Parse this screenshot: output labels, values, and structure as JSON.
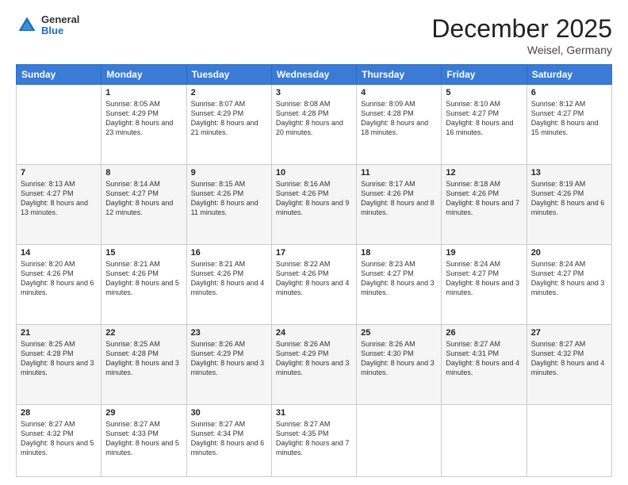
{
  "header": {
    "logo_general": "General",
    "logo_blue": "Blue",
    "month_title": "December 2025",
    "location": "Weisel, Germany"
  },
  "calendar": {
    "days_of_week": [
      "Sunday",
      "Monday",
      "Tuesday",
      "Wednesday",
      "Thursday",
      "Friday",
      "Saturday"
    ],
    "weeks": [
      [
        {
          "day": "",
          "sunrise": "",
          "sunset": "",
          "daylight": ""
        },
        {
          "day": "1",
          "sunrise": "Sunrise: 8:05 AM",
          "sunset": "Sunset: 4:29 PM",
          "daylight": "Daylight: 8 hours and 23 minutes."
        },
        {
          "day": "2",
          "sunrise": "Sunrise: 8:07 AM",
          "sunset": "Sunset: 4:29 PM",
          "daylight": "Daylight: 8 hours and 21 minutes."
        },
        {
          "day": "3",
          "sunrise": "Sunrise: 8:08 AM",
          "sunset": "Sunset: 4:28 PM",
          "daylight": "Daylight: 8 hours and 20 minutes."
        },
        {
          "day": "4",
          "sunrise": "Sunrise: 8:09 AM",
          "sunset": "Sunset: 4:28 PM",
          "daylight": "Daylight: 8 hours and 18 minutes."
        },
        {
          "day": "5",
          "sunrise": "Sunrise: 8:10 AM",
          "sunset": "Sunset: 4:27 PM",
          "daylight": "Daylight: 8 hours and 16 minutes."
        },
        {
          "day": "6",
          "sunrise": "Sunrise: 8:12 AM",
          "sunset": "Sunset: 4:27 PM",
          "daylight": "Daylight: 8 hours and 15 minutes."
        }
      ],
      [
        {
          "day": "7",
          "sunrise": "Sunrise: 8:13 AM",
          "sunset": "Sunset: 4:27 PM",
          "daylight": "Daylight: 8 hours and 13 minutes."
        },
        {
          "day": "8",
          "sunrise": "Sunrise: 8:14 AM",
          "sunset": "Sunset: 4:27 PM",
          "daylight": "Daylight: 8 hours and 12 minutes."
        },
        {
          "day": "9",
          "sunrise": "Sunrise: 8:15 AM",
          "sunset": "Sunset: 4:26 PM",
          "daylight": "Daylight: 8 hours and 11 minutes."
        },
        {
          "day": "10",
          "sunrise": "Sunrise: 8:16 AM",
          "sunset": "Sunset: 4:26 PM",
          "daylight": "Daylight: 8 hours and 9 minutes."
        },
        {
          "day": "11",
          "sunrise": "Sunrise: 8:17 AM",
          "sunset": "Sunset: 4:26 PM",
          "daylight": "Daylight: 8 hours and 8 minutes."
        },
        {
          "day": "12",
          "sunrise": "Sunrise: 8:18 AM",
          "sunset": "Sunset: 4:26 PM",
          "daylight": "Daylight: 8 hours and 7 minutes."
        },
        {
          "day": "13",
          "sunrise": "Sunrise: 8:19 AM",
          "sunset": "Sunset: 4:26 PM",
          "daylight": "Daylight: 8 hours and 6 minutes."
        }
      ],
      [
        {
          "day": "14",
          "sunrise": "Sunrise: 8:20 AM",
          "sunset": "Sunset: 4:26 PM",
          "daylight": "Daylight: 8 hours and 6 minutes."
        },
        {
          "day": "15",
          "sunrise": "Sunrise: 8:21 AM",
          "sunset": "Sunset: 4:26 PM",
          "daylight": "Daylight: 8 hours and 5 minutes."
        },
        {
          "day": "16",
          "sunrise": "Sunrise: 8:21 AM",
          "sunset": "Sunset: 4:26 PM",
          "daylight": "Daylight: 8 hours and 4 minutes."
        },
        {
          "day": "17",
          "sunrise": "Sunrise: 8:22 AM",
          "sunset": "Sunset: 4:26 PM",
          "daylight": "Daylight: 8 hours and 4 minutes."
        },
        {
          "day": "18",
          "sunrise": "Sunrise: 8:23 AM",
          "sunset": "Sunset: 4:27 PM",
          "daylight": "Daylight: 8 hours and 3 minutes."
        },
        {
          "day": "19",
          "sunrise": "Sunrise: 8:24 AM",
          "sunset": "Sunset: 4:27 PM",
          "daylight": "Daylight: 8 hours and 3 minutes."
        },
        {
          "day": "20",
          "sunrise": "Sunrise: 8:24 AM",
          "sunset": "Sunset: 4:27 PM",
          "daylight": "Daylight: 8 hours and 3 minutes."
        }
      ],
      [
        {
          "day": "21",
          "sunrise": "Sunrise: 8:25 AM",
          "sunset": "Sunset: 4:28 PM",
          "daylight": "Daylight: 8 hours and 3 minutes."
        },
        {
          "day": "22",
          "sunrise": "Sunrise: 8:25 AM",
          "sunset": "Sunset: 4:28 PM",
          "daylight": "Daylight: 8 hours and 3 minutes."
        },
        {
          "day": "23",
          "sunrise": "Sunrise: 8:26 AM",
          "sunset": "Sunset: 4:29 PM",
          "daylight": "Daylight: 8 hours and 3 minutes."
        },
        {
          "day": "24",
          "sunrise": "Sunrise: 8:26 AM",
          "sunset": "Sunset: 4:29 PM",
          "daylight": "Daylight: 8 hours and 3 minutes."
        },
        {
          "day": "25",
          "sunrise": "Sunrise: 8:26 AM",
          "sunset": "Sunset: 4:30 PM",
          "daylight": "Daylight: 8 hours and 3 minutes."
        },
        {
          "day": "26",
          "sunrise": "Sunrise: 8:27 AM",
          "sunset": "Sunset: 4:31 PM",
          "daylight": "Daylight: 8 hours and 4 minutes."
        },
        {
          "day": "27",
          "sunrise": "Sunrise: 8:27 AM",
          "sunset": "Sunset: 4:32 PM",
          "daylight": "Daylight: 8 hours and 4 minutes."
        }
      ],
      [
        {
          "day": "28",
          "sunrise": "Sunrise: 8:27 AM",
          "sunset": "Sunset: 4:32 PM",
          "daylight": "Daylight: 8 hours and 5 minutes."
        },
        {
          "day": "29",
          "sunrise": "Sunrise: 8:27 AM",
          "sunset": "Sunset: 4:33 PM",
          "daylight": "Daylight: 8 hours and 5 minutes."
        },
        {
          "day": "30",
          "sunrise": "Sunrise: 8:27 AM",
          "sunset": "Sunset: 4:34 PM",
          "daylight": "Daylight: 8 hours and 6 minutes."
        },
        {
          "day": "31",
          "sunrise": "Sunrise: 8:27 AM",
          "sunset": "Sunset: 4:35 PM",
          "daylight": "Daylight: 8 hours and 7 minutes."
        },
        {
          "day": "",
          "sunrise": "",
          "sunset": "",
          "daylight": ""
        },
        {
          "day": "",
          "sunrise": "",
          "sunset": "",
          "daylight": ""
        },
        {
          "day": "",
          "sunrise": "",
          "sunset": "",
          "daylight": ""
        }
      ]
    ]
  }
}
